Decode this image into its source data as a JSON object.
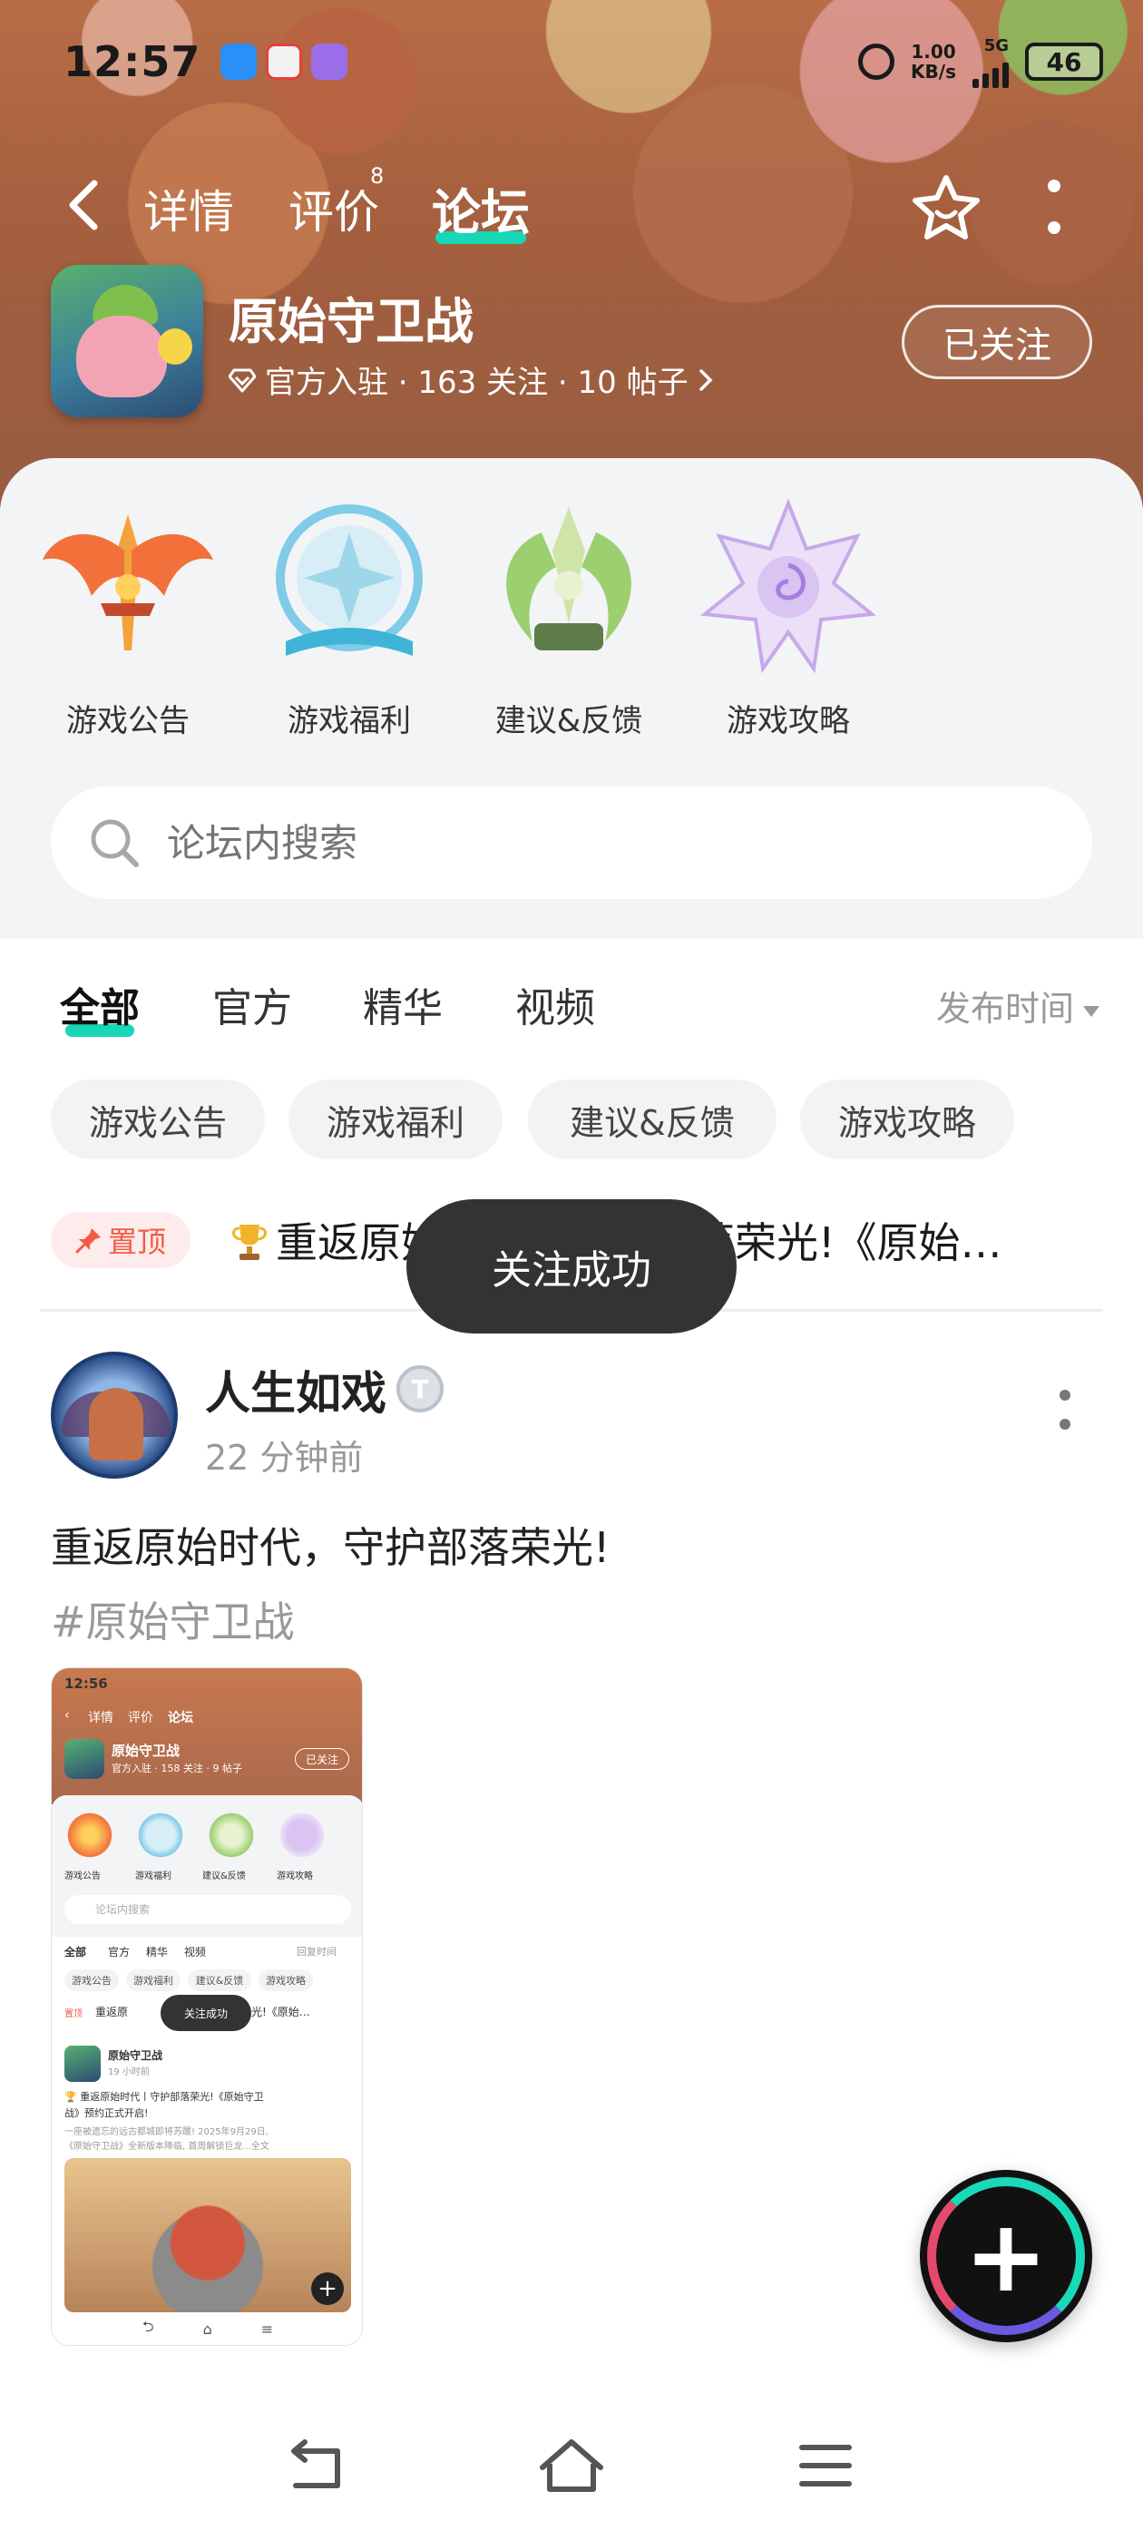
{
  "status_bar": {
    "time": "12:57",
    "net_speed_value": "1.00",
    "net_speed_unit": "KB/s",
    "network": "5G",
    "battery": "46"
  },
  "nav": {
    "tabs": [
      {
        "label": "详情",
        "active": false
      },
      {
        "label": "评价",
        "badge": "8",
        "active": false
      },
      {
        "label": "论坛",
        "active": true
      }
    ],
    "accent_color": "#18d7b6"
  },
  "game": {
    "name": "原始守卫战",
    "meta": "官方入驻 · 163 关注 · 10 帖子",
    "follow_label": "已关注"
  },
  "categories": [
    {
      "label": "游戏公告",
      "icon": "winged-sword-emblem"
    },
    {
      "label": "游戏福利",
      "icon": "crystal-book-emblem"
    },
    {
      "label": "建议&反馈",
      "icon": "leaf-crest-emblem"
    },
    {
      "label": "游戏攻略",
      "icon": "star-sigil-emblem"
    }
  ],
  "search": {
    "placeholder": "论坛内搜索"
  },
  "feed_tabs": [
    {
      "label": "全部",
      "active": true
    },
    {
      "label": "官方",
      "active": false
    },
    {
      "label": "精华",
      "active": false
    },
    {
      "label": "视频",
      "active": false
    }
  ],
  "sort_label": "发布时间",
  "chips": [
    "游戏公告",
    "游戏福利",
    "建议&反馈",
    "游戏攻略"
  ],
  "pinned": {
    "badge": "置顶",
    "text": "重返原始时代，守护部落荣光!《原始…",
    "badge_color": "#f35a45"
  },
  "toast": "关注成功",
  "post": {
    "author": "人生如戏",
    "time": "22 分钟前",
    "title": "重返原始时代，守护部落荣光!",
    "tag": "#原始守卫战",
    "thumbnail": {
      "time": "12:56",
      "tabs": [
        "详情",
        "评价",
        "论坛"
      ],
      "game_name": "原始守卫战",
      "game_meta": "官方入驻 · 158 关注 · 9 帖子",
      "follow_label": "已关注",
      "categories": [
        "游戏公告",
        "游戏福利",
        "建议&反馈",
        "游戏攻略"
      ],
      "search": "论坛内搜索",
      "feed_tabs": [
        "全部",
        "官方",
        "精华",
        "视频"
      ],
      "sort_label": "回复时间",
      "chips": [
        "游戏公告",
        "游戏福利",
        "建议&反馈",
        "游戏攻略"
      ],
      "pinned_badge": "置顶",
      "pinned_text_start": "重返原",
      "pinned_text_end": "落荣光!《原始…",
      "toast": "关注成功",
      "post_author": "原始守卫战",
      "post_time": "19 小时前",
      "post_title_line1": "🏆 重返原始时代丨守护部落荣光!《原始守卫",
      "post_title_line2": "战》预约正式开启!",
      "post_body_line1": "一座被遗忘的远古都城即将苏醒! 2025年9月29日,",
      "post_body_line2": "《原始守卫战》全新版本降临, 首周解锁巨龙...全文"
    }
  }
}
